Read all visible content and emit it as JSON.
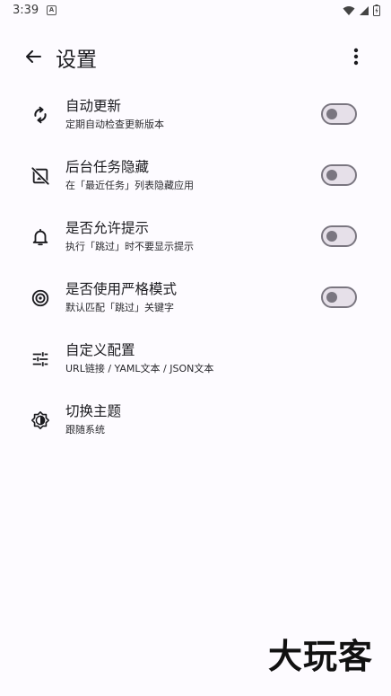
{
  "status_bar": {
    "time": "3:39",
    "notification_icon": "A"
  },
  "app_bar": {
    "title": "设置"
  },
  "settings": [
    {
      "id": "auto-update",
      "icon": "sync-icon",
      "title": "自动更新",
      "subtitle": "定期自动检查更新版本",
      "has_toggle": true,
      "toggle_on": false
    },
    {
      "id": "hide-background",
      "icon": "hide-image-icon",
      "title": "后台任务隐藏",
      "subtitle": "在「最近任务」列表隐藏应用",
      "has_toggle": true,
      "toggle_on": false
    },
    {
      "id": "allow-hint",
      "icon": "bell-icon",
      "title": "是否允许提示",
      "subtitle": "执行「跳过」时不要显示提示",
      "has_toggle": true,
      "toggle_on": false
    },
    {
      "id": "strict-mode",
      "icon": "target-icon",
      "title": "是否使用严格模式",
      "subtitle": "默认匹配「跳过」关键字",
      "has_toggle": true,
      "toggle_on": false
    },
    {
      "id": "custom-config",
      "icon": "tune-icon",
      "title": "自定义配置",
      "subtitle": "URL链接 / YAML文本 / JSON文本",
      "has_toggle": false
    },
    {
      "id": "switch-theme",
      "icon": "brightness-icon",
      "title": "切换主题",
      "subtitle": "跟随系统",
      "has_toggle": false
    }
  ],
  "watermark": "大玩客",
  "colors": {
    "background": "#fdfbff",
    "toggle_track": "#e6e0e9",
    "toggle_outline": "#7a7680"
  }
}
